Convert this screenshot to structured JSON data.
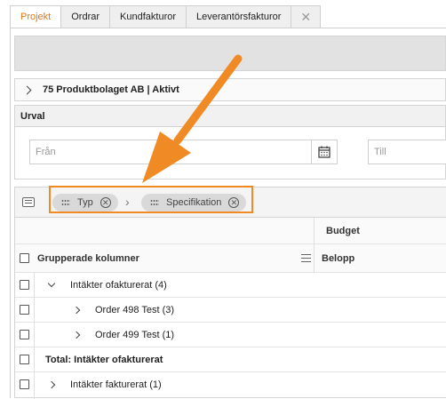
{
  "tabs": [
    {
      "label": "Projekt",
      "active": true
    },
    {
      "label": "Ordrar",
      "active": false
    },
    {
      "label": "Kundfakturor",
      "active": false
    },
    {
      "label": "Leverantörsfakturor",
      "active": false
    }
  ],
  "tab_close_symbol": "✕",
  "company": {
    "label": "75 Produktbolaget AB | Aktivt"
  },
  "urval": {
    "title": "Urval",
    "from_placeholder": "Från",
    "to_placeholder": "Till",
    "calendar_icon": "calendar-icon"
  },
  "grouping": {
    "chips": [
      {
        "label": "Typ"
      },
      {
        "label": "Specifikation"
      }
    ],
    "separator": "›"
  },
  "table": {
    "budget_header": "Budget",
    "grouped_columns_label": "Grupperade kolumner",
    "belopp_header": "Belopp",
    "rows": [
      {
        "label": "Intäkter ofakturerat (4)",
        "level": 0,
        "expanded": true
      },
      {
        "label": "Order 498 Test (3)",
        "level": 1,
        "expanded": false
      },
      {
        "label": "Order 499 Test (1)",
        "level": 1,
        "expanded": false
      },
      {
        "label": "Total: Intäkter ofakturerat",
        "level": 0,
        "bold": true
      },
      {
        "label": "Intäkter fakturerat (1)",
        "level": 0,
        "expanded": false
      }
    ]
  },
  "colors": {
    "accent": "#e07b1a",
    "annotation": "#f08a24"
  }
}
